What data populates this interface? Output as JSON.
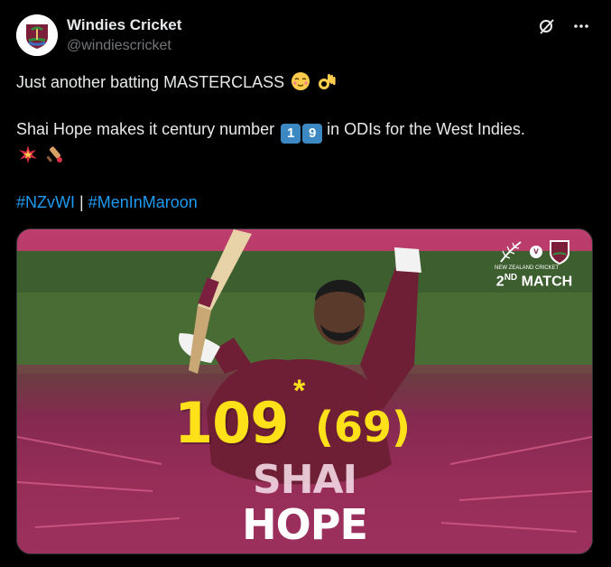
{
  "author": {
    "name": "Windies Cricket",
    "handle": "@windiescricket"
  },
  "tweet": {
    "line1": "Just another batting MASTERCLASS",
    "line2_prefix": "Shai Hope makes it century number",
    "keycap1": "1",
    "keycap2": "9",
    "line2_suffix": "in ODIs for the West Indies.",
    "hashtag1": "#NZvWI",
    "separator": "|",
    "hashtag2": "#MenInMaroon"
  },
  "media": {
    "runs": "109",
    "star": "*",
    "balls": "(69)",
    "first_name": "SHAI",
    "last_name": "HOPE",
    "vs": "v",
    "match_number": "2",
    "match_suffix": "ND",
    "match_word": "MATCH",
    "nz_logo_text": "NEW ZEALAND CRICKET"
  },
  "colors": {
    "hashtag": "#1d9bf0",
    "score": "#ffe11a",
    "maroon": "#7a2a4d"
  },
  "icons": [
    "grok-icon",
    "more-icon"
  ]
}
